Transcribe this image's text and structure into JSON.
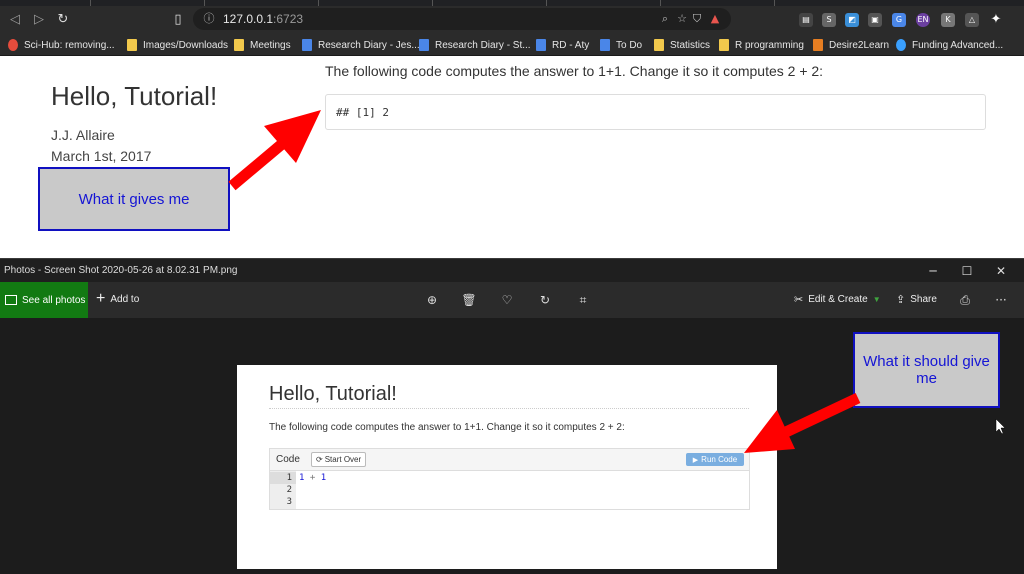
{
  "browser": {
    "url_host": "127.0.0.1",
    "url_port": ":6723",
    "bookmarks": [
      {
        "label": "Sci-Hub: removing...",
        "kind": "red"
      },
      {
        "label": "Images/Downloads",
        "kind": "folder"
      },
      {
        "label": "Meetings",
        "kind": "folder"
      },
      {
        "label": "Research Diary - Jes...",
        "kind": "doc"
      },
      {
        "label": "Research Diary - St...",
        "kind": "doc"
      },
      {
        "label": "RD - Aty",
        "kind": "doc"
      },
      {
        "label": "To Do",
        "kind": "doc"
      },
      {
        "label": "Statistics",
        "kind": "folder"
      },
      {
        "label": "R programming",
        "kind": "folder"
      },
      {
        "label": "Desire2Learn",
        "kind": "d2l"
      },
      {
        "label": "Funding Advanced...",
        "kind": "fund"
      }
    ],
    "extension_badge": "EN"
  },
  "webpage": {
    "title": "Hello, Tutorial!",
    "author": "J.J. Allaire",
    "date": "March 1st, 2017",
    "intro": "The following code computes the answer to 1+1. Change it so it computes 2 + 2:",
    "output": "## [1] 2"
  },
  "annotations": {
    "gives": "What it gives me",
    "should": "What it should give me"
  },
  "photos": {
    "window_title": "Photos - Screen Shot 2020-05-26 at 8.02.31 PM.png",
    "see_all": "See all photos",
    "add_to": "Add to",
    "edit_create": "Edit & Create",
    "share": "Share",
    "more": "···"
  },
  "shot": {
    "title": "Hello, Tutorial!",
    "intro": "The following code computes the answer to 1+1. Change it so it computes 2 + 2:",
    "code_label": "Code",
    "start_over": "Start Over",
    "run_code": "Run Code",
    "line_numbers": [
      "1",
      "2",
      "3"
    ],
    "code_num_a": "1",
    "code_op": "+",
    "code_num_b": "1"
  },
  "colors": {
    "annotation_text": "#1515d5",
    "annotation_border": "#1010c0",
    "arrow": "#ff0000",
    "photos_green": "#127a12",
    "run_code": "#7aaee0"
  }
}
